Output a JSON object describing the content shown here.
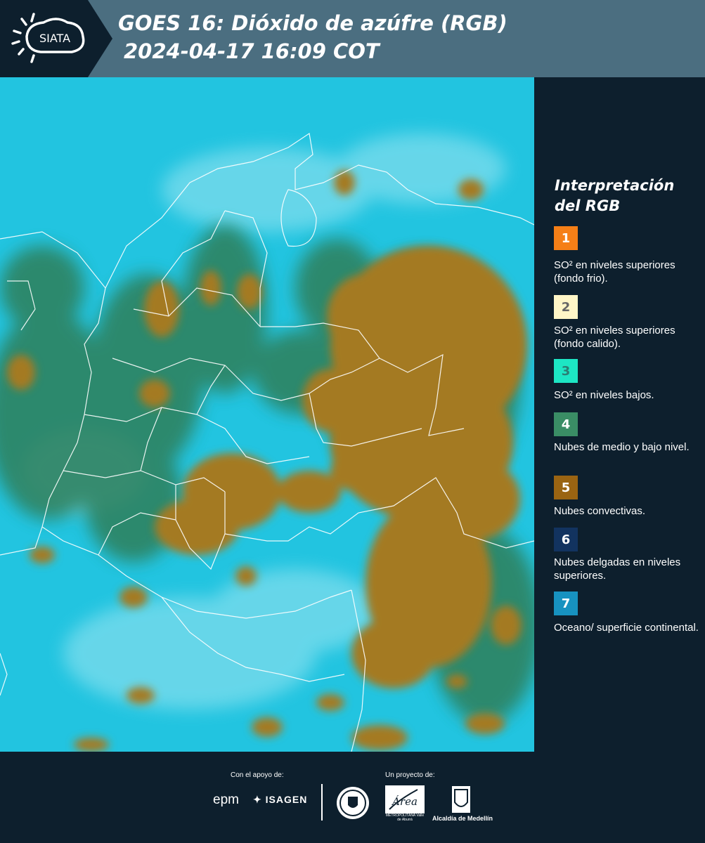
{
  "header": {
    "logo_text": "SIATA",
    "title_line1": "GOES 16: Dióxido de azúfre (RGB)",
    "title_line2": "2024-04-17 16:09 COT"
  },
  "colors": {
    "header_bg": "#4b6e80",
    "dark_bg": "#0d1f2d",
    "ocean": "#22c4e0",
    "convective": "#a47a24",
    "mid_low": "#2f7f5a"
  },
  "legend": {
    "title": "Interpretación del RGB",
    "items": [
      {
        "number": "1",
        "color": "#f57f17",
        "text_color": "#ffffff",
        "label": "SO² en niveles superiores (fondo frio)."
      },
      {
        "number": "2",
        "color": "#fff6c7",
        "text_color": "#666666",
        "label": "SO² en niveles superiores (fondo calido)."
      },
      {
        "number": "3",
        "color": "#1de6c4",
        "text_color": "#2a7f74",
        "label": "SO² en niveles bajos."
      },
      {
        "number": "4",
        "color": "#3a8d65",
        "text_color": "#ffffff",
        "label": "Nubes de medio y bajo nivel."
      },
      {
        "number": "5",
        "color": "#9a6412",
        "text_color": "#ffffff",
        "label": "Nubes convectivas."
      },
      {
        "number": "6",
        "color": "#12335f",
        "text_color": "#ffffff",
        "label": "Nubes delgadas en niveles superiores."
      },
      {
        "number": "7",
        "color": "#1792c0",
        "text_color": "#ffffff",
        "label": "Oceano/ superficie continental."
      }
    ]
  },
  "footer": {
    "support_label": "Con el apoyo de:",
    "project_label": "Un proyecto de:",
    "epm": "epm",
    "isagen": "ISAGEN",
    "area_logo_text": "Área",
    "area_label": "METROPOLITANA Valle de Aburrá",
    "alcaldia_label": "Alcaldía de Medellín"
  }
}
